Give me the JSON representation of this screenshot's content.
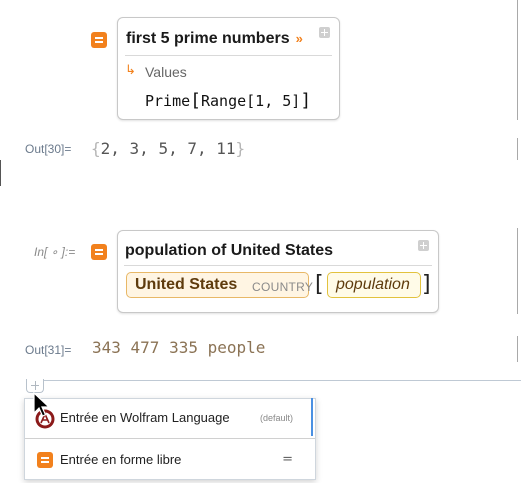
{
  "cells": {
    "box1": {
      "title": "first 5 prime numbers",
      "chevron": "»",
      "values_arrow": "↳",
      "values_label": "Values",
      "code_func": "Prime",
      "code_open": "[",
      "code_args": "Range[1, 5]",
      "code_close": "]"
    },
    "out30": {
      "label": "Out[30]=",
      "open_brace": "{",
      "values": "2, 3, 5, 7, 11",
      "close_brace": "}"
    },
    "in_pending": {
      "label": "In[ ∘ ]:="
    },
    "box2": {
      "title": "population of United States",
      "entity_name": "United States",
      "entity_type": "COUNTRY",
      "bracket_open": "[",
      "property": "population",
      "bracket_close": "]"
    },
    "out31": {
      "label": "Out[31]=",
      "value": "343 477 335 people"
    }
  },
  "insert_menu": {
    "items": [
      {
        "label": "Entrée en Wolfram Language",
        "hint": "(default)",
        "icon": "wolfram-language-icon"
      },
      {
        "label": "Entrée en forme libre",
        "hint": "=",
        "icon": "wolfram-alpha-icon"
      }
    ]
  },
  "colors": {
    "accent_orange": "#f2811d",
    "entity_border": "#e8b867",
    "property_border": "#e2c23e",
    "focus_blue": "#4a90e2"
  }
}
